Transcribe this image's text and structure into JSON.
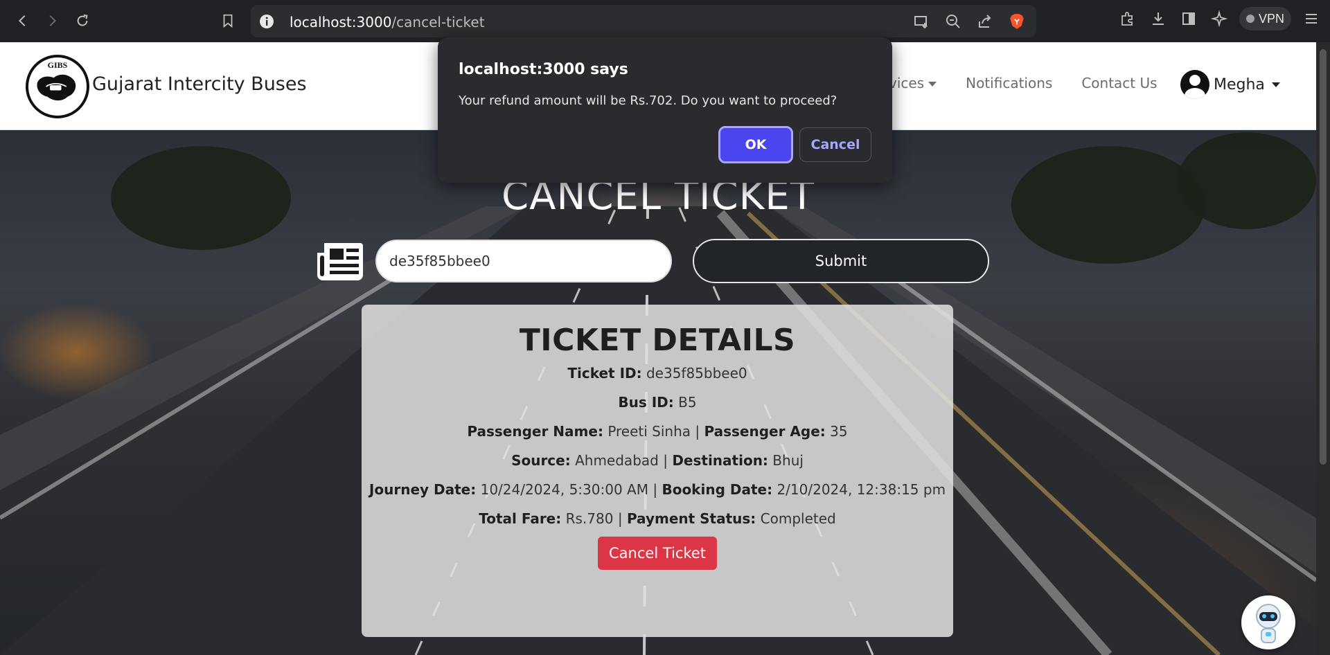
{
  "browser": {
    "url_host": "localhost:3000",
    "url_path": "/cancel-ticket",
    "vpn_label": "VPN",
    "icons": [
      "back-icon",
      "forward-icon",
      "reload-icon",
      "bookmark-icon",
      "info-icon",
      "cast-icon",
      "zoom-icon",
      "share-icon",
      "brave-icon",
      "extensions-icon",
      "download-icon",
      "sidebar-icon",
      "leo-icon",
      "menu-icon"
    ]
  },
  "navbar": {
    "logo_text": "GIBS",
    "brand": "Gujarat Intercity Buses",
    "links": [
      {
        "label": "vices",
        "dropdown": true
      },
      {
        "label": "Notifications",
        "dropdown": false
      },
      {
        "label": "Contact Us",
        "dropdown": false
      }
    ],
    "user_name": "Megha"
  },
  "main": {
    "title": "CANCEL TICKET",
    "ticket_input_value": "de35f85bbee0",
    "submit_label": "Submit"
  },
  "ticket": {
    "heading": "TICKET DETAILS",
    "labels": {
      "ticket_id": "Ticket ID:",
      "bus_id": "Bus ID:",
      "passenger_name": "Passenger Name:",
      "passenger_age": "Passenger Age:",
      "source": "Source:",
      "destination": "Destination:",
      "journey_date": "Journey Date:",
      "booking_date": "Booking Date:",
      "total_fare": "Total Fare:",
      "payment_status": "Payment Status:"
    },
    "values": {
      "ticket_id": "de35f85bbee0",
      "bus_id": "B5",
      "passenger_name": "Preeti Sinha",
      "passenger_age": "35",
      "source": "Ahmedabad",
      "destination": "Bhuj",
      "journey_date": "10/24/2024, 5:30:00 AM",
      "booking_date": "2/10/2024, 12:38:15 pm",
      "total_fare": "Rs.780",
      "payment_status": "Completed"
    },
    "separator": "|",
    "cancel_label": "Cancel Ticket"
  },
  "dialog": {
    "title": "localhost:3000 says",
    "message": "Your refund amount will be Rs.702. Do you want to proceed?",
    "ok_label": "OK",
    "cancel_label": "Cancel"
  },
  "colors": {
    "chrome_bg": "#202124",
    "danger": "#dc3545",
    "dialog_primary": "#4b45f0",
    "dark_button": "#212529"
  }
}
